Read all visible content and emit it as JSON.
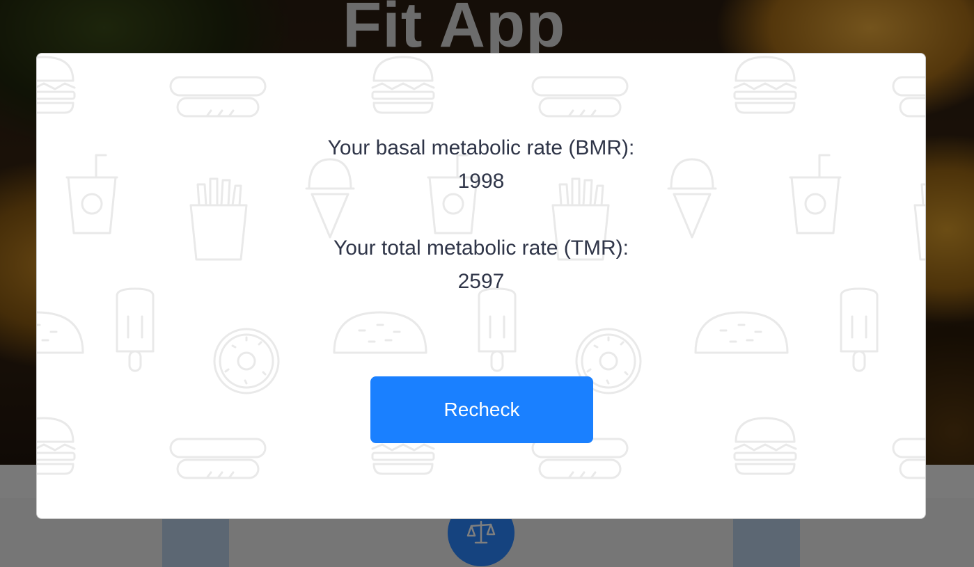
{
  "app": {
    "title": "Fit App"
  },
  "results": {
    "bmr_label": "Your basal metabolic rate (BMR):",
    "bmr_value": "1998",
    "tmr_label": "Your total metabolic rate (TMR):",
    "tmr_value": "2597"
  },
  "actions": {
    "recheck_label": "Recheck"
  },
  "icons": {
    "background_pattern": [
      "burger-icon",
      "hotdog-icon",
      "soda-cup-icon",
      "fries-icon",
      "ice-cream-cone-icon",
      "popsicle-icon",
      "donut-icon",
      "taco-icon"
    ],
    "nav_center": "scale-icon"
  },
  "colors": {
    "primary_button": "#1a80ff",
    "nav_circle": "#2a86ff",
    "text": "#2f3548",
    "pattern_stroke": "#e9e9e9"
  }
}
